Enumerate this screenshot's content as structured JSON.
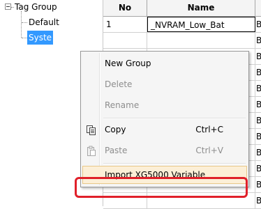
{
  "tree": {
    "root_label": "Tag Group",
    "children": [
      {
        "label": "Default"
      },
      {
        "label": "Syste"
      }
    ]
  },
  "grid": {
    "columns": [
      "No",
      "Name"
    ],
    "rows": [
      {
        "no": "1",
        "name": "_NVRAM_Low_Bat",
        "stub": "B"
      }
    ],
    "stub_letter": "B"
  },
  "context_menu": {
    "items": [
      {
        "label": "New Group",
        "shortcut": "",
        "enabled": true
      },
      {
        "label": "Delete",
        "shortcut": "",
        "enabled": false
      },
      {
        "label": "Rename",
        "shortcut": "",
        "enabled": false
      },
      {
        "label": "Copy",
        "shortcut": "Ctrl+C",
        "enabled": true,
        "icon": "copy-icon"
      },
      {
        "label": "Paste",
        "shortcut": "Ctrl+V",
        "enabled": false,
        "icon": "paste-icon"
      },
      {
        "label": "Import XG5000 Variable",
        "shortcut": "",
        "enabled": true,
        "highlighted": true
      }
    ]
  },
  "colors": {
    "selection": "#3399ff",
    "annotation_ring": "#e0202a",
    "menu_hover": "#fcefd7"
  }
}
